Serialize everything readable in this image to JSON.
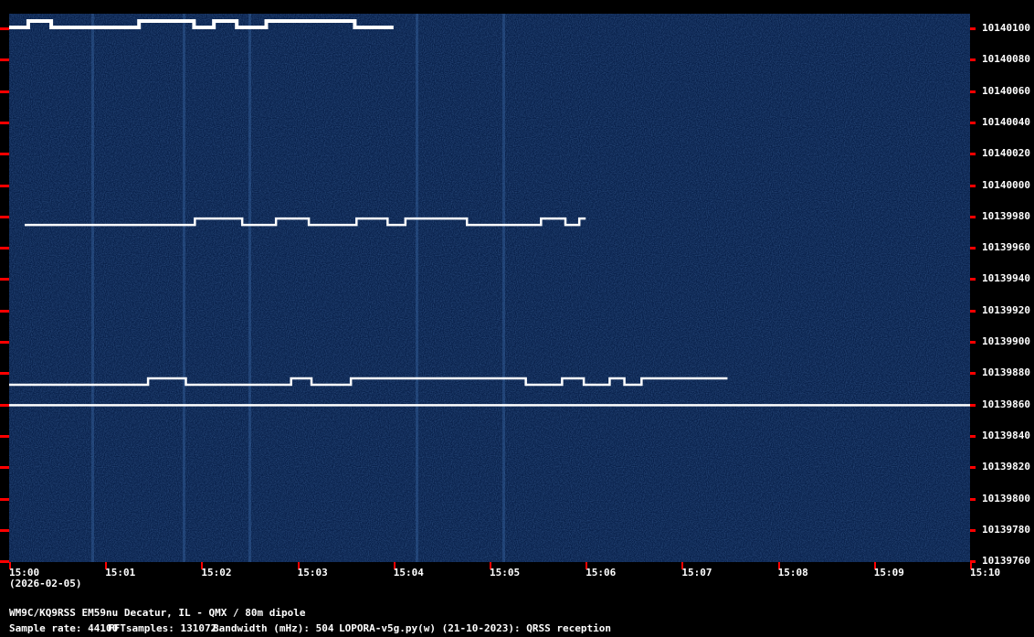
{
  "window": {
    "date": "(2026-02-05)"
  },
  "axes": {
    "frequency_labels": [
      "10140100",
      "10140080",
      "10140060",
      "10140040",
      "10140020",
      "10140000",
      "10139980",
      "10139960",
      "10139940",
      "10139920",
      "10139900",
      "10139880",
      "10139860",
      "10139840",
      "10139820",
      "10139800",
      "10139780",
      "10139760"
    ],
    "time_labels": [
      "15:00",
      "15:01",
      "15:02",
      "15:03",
      "15:04",
      "15:05",
      "15:06",
      "15:07",
      "15:08",
      "15:09",
      "15:10"
    ]
  },
  "footer": {
    "station": "WM9C/KQ9RSS EM59nu Decatur, IL - QMX / 80m dipole",
    "sample_rate": "Sample rate: 44100",
    "fft_samples": "FFTsamples: 131072",
    "bandwidth": "Bandwidth (mHz): 504",
    "software": "LOPORA-v5g.py(w) (21-10-2023): QRSS reception"
  },
  "colors": {
    "background": "#08204a",
    "trace": "#ffffff",
    "ticks": "#ff0000"
  },
  "signals": [
    {
      "freq_hz": 10139974,
      "start": "15:00",
      "end": "15:06"
    },
    {
      "freq_hz": 10139872,
      "start": "15:00",
      "end": "15:07"
    },
    {
      "freq_hz": 10139859,
      "start": "15:00",
      "end": "15:10"
    },
    {
      "freq_hz": 10140100,
      "start": "15:00",
      "end": "15:04"
    }
  ]
}
